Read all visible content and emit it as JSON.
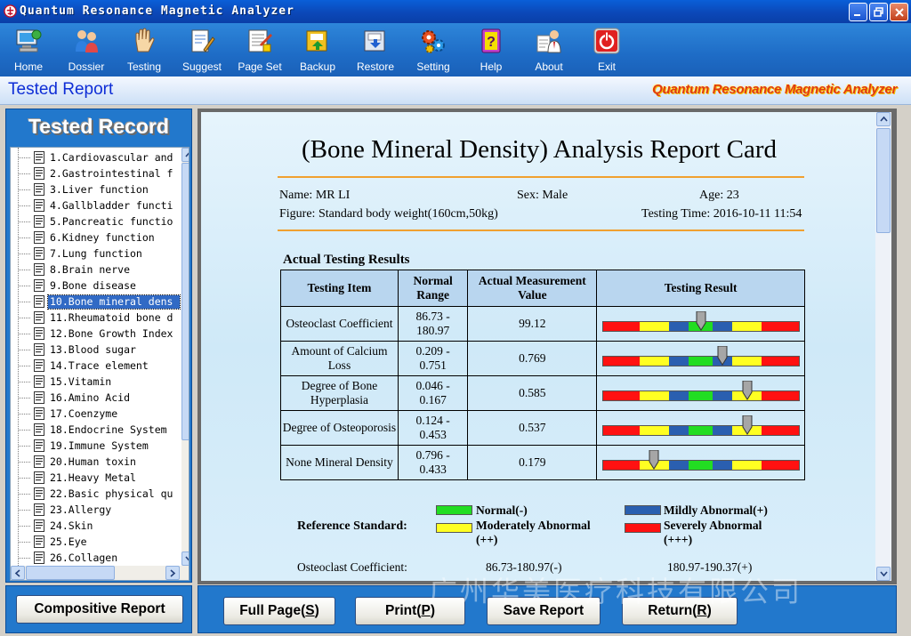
{
  "window": {
    "title": "Quantum Resonance Magnetic Analyzer"
  },
  "toolbar": {
    "items": [
      {
        "label": "Home",
        "icon": "home-computer-icon"
      },
      {
        "label": "Dossier",
        "icon": "people-icon"
      },
      {
        "label": "Testing",
        "icon": "hand-icon"
      },
      {
        "label": "Suggest",
        "icon": "document-edit-icon"
      },
      {
        "label": "Page Set",
        "icon": "page-setup-icon"
      },
      {
        "label": "Backup",
        "icon": "backup-icon"
      },
      {
        "label": "Restore",
        "icon": "restore-icon"
      },
      {
        "label": "Setting",
        "icon": "gears-icon"
      },
      {
        "label": "Help",
        "icon": "help-book-icon"
      },
      {
        "label": "About",
        "icon": "about-person-icon"
      },
      {
        "label": "Exit",
        "icon": "power-icon"
      }
    ]
  },
  "header": {
    "section_title": "Tested Report",
    "brand": "Quantum Resonance Magnetic Analyzer"
  },
  "left_panel": {
    "title": "Tested Record",
    "items": [
      "1.Cardiovascular and",
      "2.Gastrointestinal f",
      "3.Liver function",
      "4.Gallbladder functi",
      "5.Pancreatic functio",
      "6.Kidney function",
      "7.Lung function",
      "8.Brain nerve",
      "9.Bone disease",
      "10.Bone mineral dens",
      "11.Rheumatoid bone d",
      "12.Bone Growth Index",
      "13.Blood sugar",
      "14.Trace element",
      "15.Vitamin",
      "16.Amino Acid",
      "17.Coenzyme",
      "18.Endocrine System",
      "19.Immune System",
      "20.Human toxin",
      "21.Heavy Metal",
      "22.Basic physical qu",
      "23.Allergy",
      "24.Skin",
      "25.Eye",
      "26.Collagen"
    ],
    "selected_index": 9,
    "composite_button": "Compositive Report"
  },
  "report": {
    "title": "(Bone Mineral Density) Analysis Report Card",
    "name": "Name: MR LI",
    "sex": "Sex: Male",
    "age": "Age: 23",
    "figure": "Figure: Standard body weight(160cm,50kg)",
    "testing_time": "Testing Time: 2016-10-11 11:54",
    "section_heading": "Actual Testing Results",
    "columns": [
      "Testing Item",
      "Normal Range",
      "Actual Measurement Value",
      "Testing Result"
    ],
    "rows": [
      {
        "item": "Osteoclast Coefficient",
        "range": "86.73 - 180.97",
        "value": "99.12",
        "marker": 0.5
      },
      {
        "item": "Amount of Calcium Loss",
        "range": "0.209 - 0.751",
        "value": "0.769",
        "marker": 0.61
      },
      {
        "item": "Degree of Bone Hyperplasia",
        "range": "0.046 - 0.167",
        "value": "0.585",
        "marker": 0.74
      },
      {
        "item": "Degree of Osteoporosis",
        "range": "0.124 - 0.453",
        "value": "0.537",
        "marker": 0.74
      },
      {
        "item": "None Mineral Density",
        "range": "0.796 - 0.433",
        "value": "0.179",
        "marker": 0.26
      }
    ],
    "reference": {
      "label": "Reference Standard:",
      "normal": "Normal(-)",
      "mild": "Mildly Abnormal(+)",
      "moderate_1": "Moderately Abnormal",
      "moderate_2": "(++)",
      "severe_1": "Severely Abnormal",
      "severe_2": "(+++)"
    },
    "osteoclast_ref": {
      "label": "Osteoclast Coefficient:",
      "normal": "86.73-180.97(-)",
      "mild": "180.97-190.37(+)"
    }
  },
  "bottom_buttons": {
    "full_page": "Full Page(",
    "full_page_key": "S",
    "print": "Print(",
    "print_key": "P",
    "save": "Save Report",
    "return": "Return(",
    "return_key": "R"
  },
  "colors": {
    "normal": "#22dd22",
    "mild": "#2a5fb0",
    "moderate": "#ffff22",
    "severe": "#ff1111"
  },
  "watermark": "广州华美医疗科技有限公司"
}
